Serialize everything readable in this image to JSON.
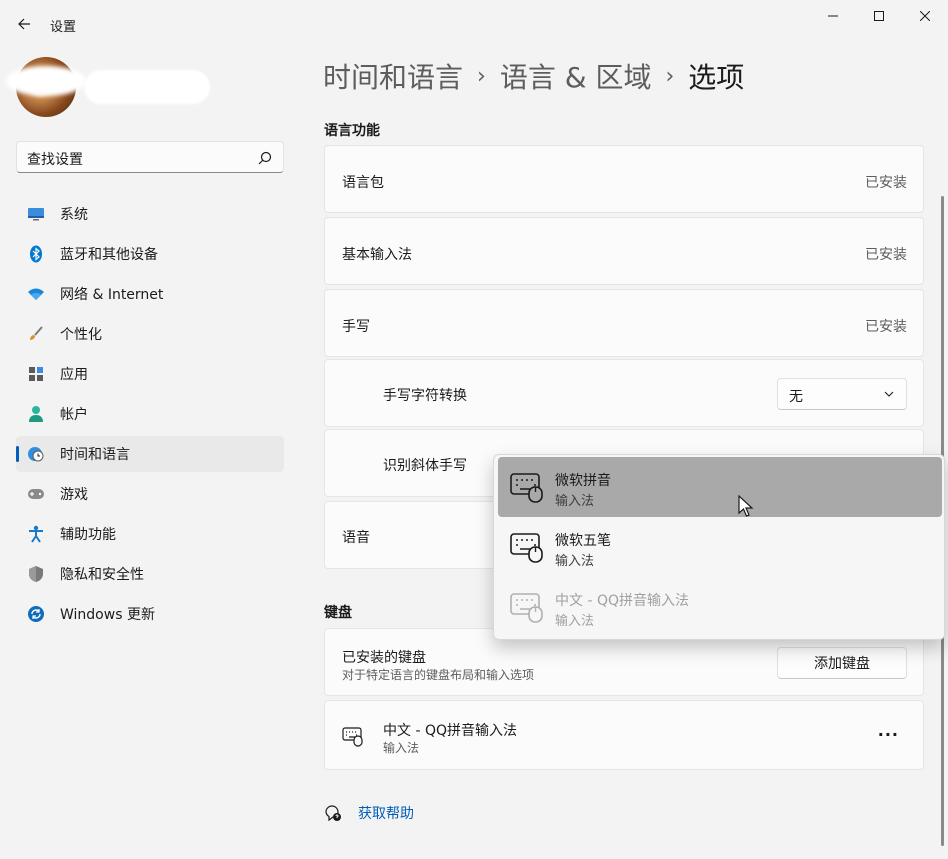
{
  "window": {
    "title": "设置"
  },
  "search": {
    "placeholder": "查找设置"
  },
  "sidebar": {
    "items": [
      {
        "label": "系统",
        "icon": "monitor-icon"
      },
      {
        "label": "蓝牙和其他设备",
        "icon": "bluetooth-icon"
      },
      {
        "label": "网络 & Internet",
        "icon": "wifi-icon"
      },
      {
        "label": "个性化",
        "icon": "brush-icon"
      },
      {
        "label": "应用",
        "icon": "apps-icon"
      },
      {
        "label": "帐户",
        "icon": "person-icon"
      },
      {
        "label": "时间和语言",
        "icon": "globe-clock-icon",
        "active": true
      },
      {
        "label": "游戏",
        "icon": "gamepad-icon"
      },
      {
        "label": "辅助功能",
        "icon": "accessibility-icon"
      },
      {
        "label": "隐私和安全性",
        "icon": "shield-icon"
      },
      {
        "label": "Windows 更新",
        "icon": "update-icon"
      }
    ]
  },
  "breadcrumb": {
    "part1": "时间和语言",
    "sep": "›",
    "part2": "语言 & 区域",
    "current": "选项"
  },
  "language_features": {
    "title": "语言功能",
    "language_pack": {
      "label": "语言包",
      "status": "已安装"
    },
    "basic_typing": {
      "label": "基本输入法",
      "status": "已安装"
    },
    "handwriting": {
      "label": "手写",
      "status": "已安装"
    },
    "handwriting_conversion": {
      "label": "手写字符转换",
      "value": "无"
    },
    "cursive_handwriting": {
      "label": "识别斜体手写"
    },
    "speech": {
      "label": "语音"
    }
  },
  "keyboard": {
    "title": "键盘",
    "installed": {
      "label": "已安装的键盘",
      "description": "对于特定语言的键盘布局和输入选项",
      "button": "添加键盘"
    },
    "items": [
      {
        "name": "中文 - QQ拼音输入法",
        "type": "输入法",
        "more": "···"
      }
    ]
  },
  "help": {
    "label": "获取帮助"
  },
  "popup": {
    "items": [
      {
        "name": "微软拼音",
        "type": "输入法",
        "state": "hover"
      },
      {
        "name": "微软五笔",
        "type": "输入法",
        "state": "normal"
      },
      {
        "name": "中文 - QQ拼音输入法",
        "type": "输入法",
        "state": "disabled"
      }
    ]
  },
  "colors": {
    "accent": "#005fb8",
    "background": "#f3f3f3",
    "card": "#fbfbfb",
    "hover": "#a9a9a9"
  }
}
